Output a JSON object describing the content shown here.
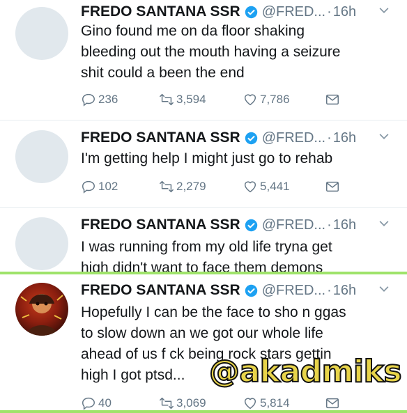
{
  "tweets": [
    {
      "name": "FREDO SANTANA SSR",
      "handle": "@FRED...",
      "time": "16h",
      "lines": [
        "Gino found me on da floor shaking",
        "bleeding out the mouth having a seizure",
        "shit could a been the end"
      ],
      "replies": "236",
      "retweets": "3,594",
      "likes": "7,786"
    },
    {
      "name": "FREDO SANTANA SSR",
      "handle": "@FRED...",
      "time": "16h",
      "lines": [
        "I'm getting help I might just go to rehab"
      ],
      "replies": "102",
      "retweets": "2,279",
      "likes": "5,441"
    },
    {
      "name": "FREDO SANTANA SSR",
      "handle": "@FRED...",
      "time": "16h",
      "lines": [
        "I was running from my old life tryna get",
        "high didn't want to face them demons"
      ]
    },
    {
      "name": "FREDO SANTANA SSR",
      "handle": "@FRED...",
      "time": "16h",
      "lines": [
        "Hopefully I can be the face to sho n ggas",
        "to slow down an we got our whole life",
        "ahead of us f  ck being rock stars gettin",
        "high I got ptsd..."
      ],
      "replies": "40",
      "retweets": "3,069",
      "likes": "5,814"
    }
  ],
  "watermark": "@akadmiks",
  "colors": {
    "text": "#14171a",
    "secondary": "#657786",
    "verified": "#1da1f2",
    "divider_green": "#9fe36a",
    "watermark_fill": "#e8d44a"
  },
  "icons": [
    "verified-badge-icon",
    "chevron-down-icon",
    "reply-icon",
    "retweet-icon",
    "like-icon",
    "message-icon"
  ]
}
